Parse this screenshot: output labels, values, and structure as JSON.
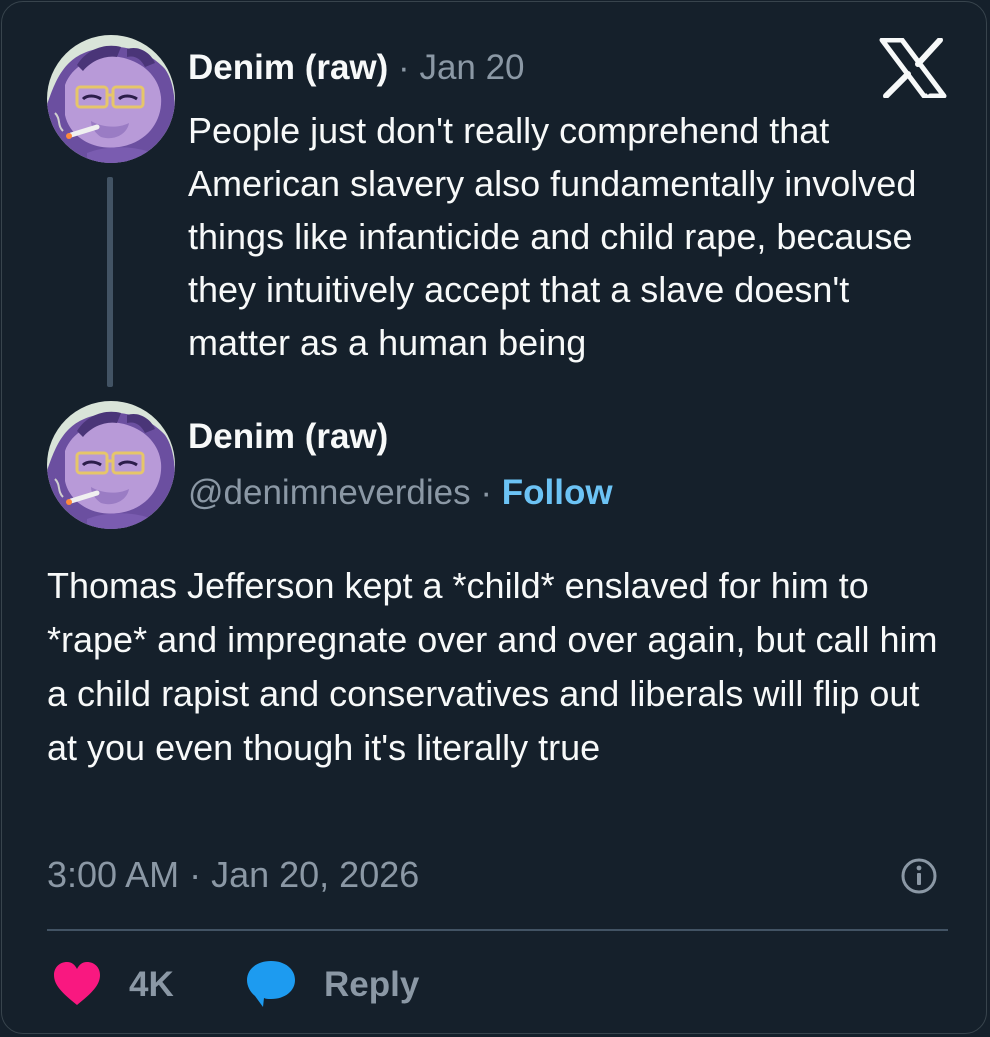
{
  "quoted_post": {
    "author_name": "Denim (raw)",
    "separator": "·",
    "date": "Jan 20",
    "text": "People just don't really comprehend that American slavery also fundamentally involved things like infanticide and child rape, because they intuitively accept that a slave doesn't matter as a human being"
  },
  "main_post": {
    "author_name": "Denim (raw)",
    "handle": "@denimneverdies",
    "separator": "·",
    "follow_label": "Follow",
    "text": "Thomas Jefferson kept a *child* enslaved for him to *rape* and impregnate over and over again, but call him a child rapist and conservatives and liberals will flip out at you even though it's literally true",
    "timestamp": "3:00 AM · Jan 20, 2026"
  },
  "actions": {
    "like_count": "4K",
    "reply_label": "Reply"
  },
  "icons": {
    "brand": "x-logo-icon",
    "info": "info-icon",
    "like": "heart-icon",
    "reply": "speech-bubble-icon"
  },
  "colors": {
    "background": "#15202b",
    "text": "#f7f9f9",
    "muted": "#8b98a5",
    "link": "#6cc3f5",
    "like": "#f91880",
    "reply": "#1d9bf0",
    "thread_line": "#425364"
  }
}
